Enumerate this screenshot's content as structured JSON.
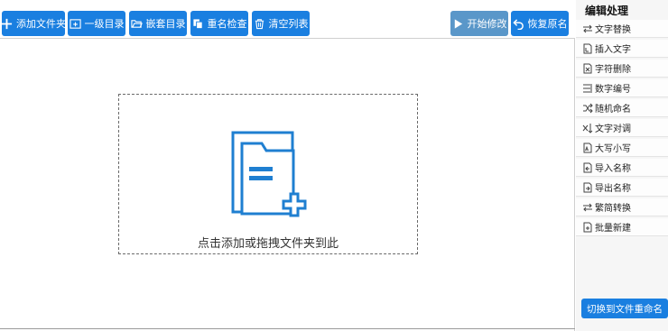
{
  "toolbar": {
    "add_folder": "添加文件夹",
    "level1_dir": "一级目录",
    "nested_dir": "嵌套目录",
    "dup_check": "重名检查",
    "clear_list": "清空列表",
    "start_modify": "开始修改",
    "restore_name": "恢复原名"
  },
  "dropzone": {
    "hint": "点击添加或拖拽文件夹到此"
  },
  "sidebar": {
    "title": "编辑处理",
    "items": [
      {
        "label": "文字替换",
        "icon": "swap-icon"
      },
      {
        "label": "插入文字",
        "icon": "insert-text-icon"
      },
      {
        "label": "字符删除",
        "icon": "delete-char-icon"
      },
      {
        "label": "数字编号",
        "icon": "numbering-icon"
      },
      {
        "label": "随机命名",
        "icon": "shuffle-icon"
      },
      {
        "label": "文字对调",
        "icon": "exchange-icon"
      },
      {
        "label": "大写小写",
        "icon": "case-icon"
      },
      {
        "label": "导入名称",
        "icon": "import-icon"
      },
      {
        "label": "导出名称",
        "icon": "export-icon"
      },
      {
        "label": "繁简转换",
        "icon": "convert-icon"
      },
      {
        "label": "批量新建",
        "icon": "batch-new-icon"
      }
    ],
    "switch_button": "切换到文件重命名"
  },
  "colors": {
    "accent": "#1a7fe0",
    "accent_dim": "#5a97c9",
    "folder": "#1f7fd1"
  }
}
